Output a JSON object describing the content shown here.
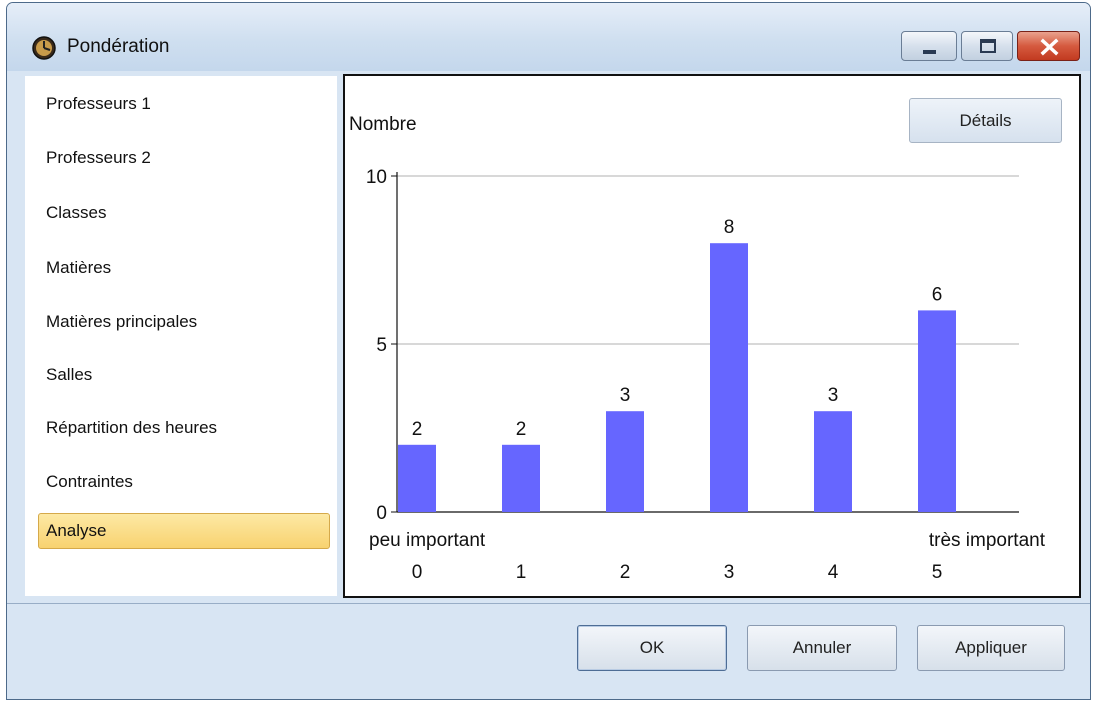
{
  "window": {
    "title": "Pondération"
  },
  "sidebar": {
    "items": [
      {
        "label": "Professeurs 1"
      },
      {
        "label": "Professeurs 2"
      },
      {
        "label": "Classes"
      },
      {
        "label": "Matières"
      },
      {
        "label": "Matières principales"
      },
      {
        "label": "Salles"
      },
      {
        "label": "Répartition des heures"
      },
      {
        "label": "Contraintes"
      },
      {
        "label": "Analyse",
        "active": true
      }
    ]
  },
  "panel": {
    "details_label": "Détails"
  },
  "chart_data": {
    "type": "bar",
    "ylabel": "Nombre",
    "ylim": [
      0,
      10
    ],
    "yticks": [
      0,
      5,
      10
    ],
    "categories": [
      "0",
      "1",
      "2",
      "3",
      "4",
      "5"
    ],
    "values": [
      2,
      2,
      3,
      8,
      3,
      6
    ],
    "x_low_label": "peu important",
    "x_high_label": "très important",
    "bar_color": "#6666ff",
    "grid": true
  },
  "footer": {
    "ok_label": "OK",
    "cancel_label": "Annuler",
    "apply_label": "Appliquer"
  },
  "colors": {
    "active_item": "#f8d270",
    "close_button": "#c9432a"
  }
}
